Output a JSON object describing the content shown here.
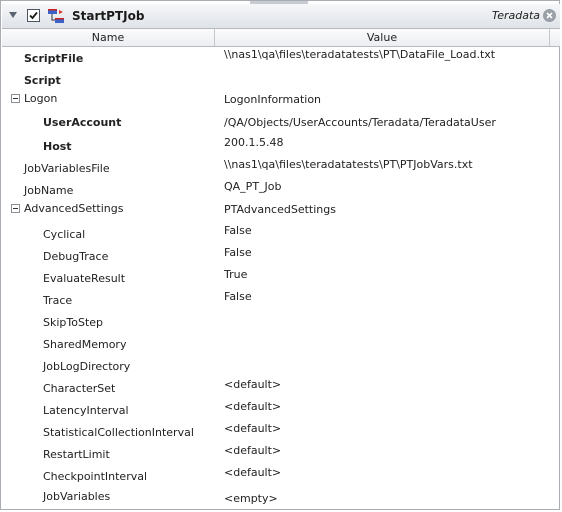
{
  "window": {
    "title": "StartPTJob",
    "vendor": "Teradata"
  },
  "columns": {
    "name": "Name",
    "value": "Value"
  },
  "properties": [
    {
      "name": "ScriptFile",
      "value": "\\\\nas1\\qa\\files\\teradatatests\\PT\\DataFile_Load.txt"
    },
    {
      "name": "Script",
      "value": ""
    },
    {
      "name": "Logon",
      "value": "LogonInformation"
    },
    {
      "name": "UserAccount",
      "value": "/QA/Objects/UserAccounts/Teradata/TeradataUser"
    },
    {
      "name": "Host",
      "value": "200.1.5.48"
    },
    {
      "name": "JobVariablesFile",
      "value": "\\\\nas1\\qa\\files\\teradatatests\\PT\\PTJobVars.txt"
    },
    {
      "name": "JobName",
      "value": "QA_PT_Job"
    },
    {
      "name": "AdvancedSettings",
      "value": "PTAdvancedSettings"
    },
    {
      "name": "Cyclical",
      "value": "False"
    },
    {
      "name": "DebugTrace",
      "value": "False"
    },
    {
      "name": "EvaluateResult",
      "value": "True"
    },
    {
      "name": "Trace",
      "value": "False"
    },
    {
      "name": "SkipToStep",
      "value": ""
    },
    {
      "name": "SharedMemory",
      "value": ""
    },
    {
      "name": "JobLogDirectory",
      "value": ""
    },
    {
      "name": "CharacterSet",
      "value": "<default>"
    },
    {
      "name": "LatencyInterval",
      "value": "<default>"
    },
    {
      "name": "StatisticalCollectionInterval",
      "value": "<default>"
    },
    {
      "name": "RestartLimit",
      "value": "<default>"
    },
    {
      "name": "CheckpointInterval",
      "value": "<default>"
    },
    {
      "name": "JobVariables",
      "value": "<empty>"
    }
  ]
}
